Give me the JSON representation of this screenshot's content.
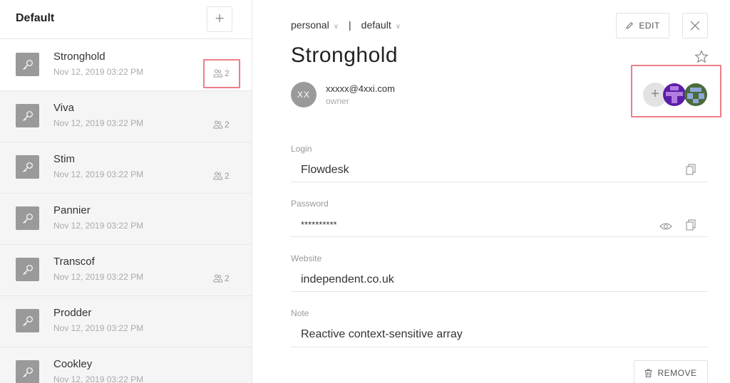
{
  "sidebar": {
    "title": "Default",
    "add_label": "+",
    "items": [
      {
        "name": "Stronghold",
        "date": "Nov 12, 2019 03:22 PM",
        "shares": "2"
      },
      {
        "name": "Viva",
        "date": "Nov 12, 2019 03:22 PM",
        "shares": "2"
      },
      {
        "name": "Stim",
        "date": "Nov 12, 2019 03:22 PM",
        "shares": "2"
      },
      {
        "name": "Pannier",
        "date": "Nov 12, 2019 03:22 PM",
        "shares": ""
      },
      {
        "name": "Transcof",
        "date": "Nov 12, 2019 03:22 PM",
        "shares": "2"
      },
      {
        "name": "Prodder",
        "date": "Nov 12, 2019 03:22 PM",
        "shares": ""
      },
      {
        "name": "Cookley",
        "date": "Nov 12, 2019 03:22 PM",
        "shares": ""
      }
    ]
  },
  "detail": {
    "crumb_vault": "personal",
    "crumb_sep": "|",
    "crumb_folder": "default",
    "edit_label": "EDIT",
    "title": "Stronghold",
    "owner": {
      "initials": "XX",
      "email": "xxxxx@4xxi.com",
      "role": "owner"
    },
    "members_add_label": "+",
    "fields": {
      "login": {
        "label": "Login",
        "value": "Flowdesk"
      },
      "password": {
        "label": "Password",
        "value": "**********"
      },
      "website": {
        "label": "Website",
        "value": "independent.co.uk"
      },
      "note": {
        "label": "Note",
        "value": "Reactive context-sensitive array"
      }
    },
    "remove_label": "REMOVE"
  },
  "colors": {
    "highlight": "#ee7d8a",
    "key_tile": "#9a9a9a",
    "avatar_purple": "#5a1fa8",
    "avatar_green": "#4a6b3a"
  }
}
